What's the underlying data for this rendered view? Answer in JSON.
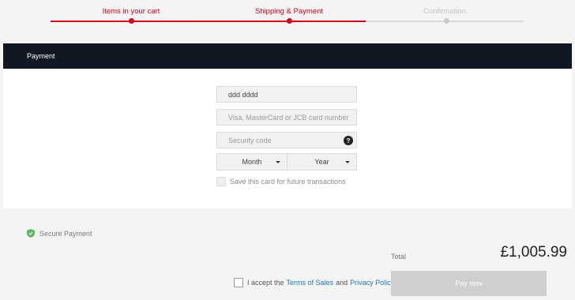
{
  "stepper": {
    "steps": [
      {
        "label": "Items in your cart",
        "state": "done"
      },
      {
        "label": "Shipping & Payment",
        "state": "current"
      },
      {
        "label": "Confirmation",
        "state": "pending"
      }
    ],
    "active_color": "#d0011b"
  },
  "payment": {
    "header": "Payment",
    "name_value": "ddd dddd",
    "card_placeholder": "Visa, MasterCard or JCB card number",
    "security_placeholder": "Security code",
    "security_help": "?",
    "month_label": "Month",
    "year_label": "Year",
    "save_card_label": "Save this card for future transactions"
  },
  "checkout": {
    "secure_label": "Secure Payment",
    "total_label": "Total",
    "total_value": "£1,005.99",
    "accept_prefix": "I accept the",
    "terms_link": "Terms of Sales",
    "and_text": "and",
    "privacy_link": "Privacy Policy.",
    "pay_button": "Pay now"
  },
  "icons": {
    "shield": "shield-check-icon",
    "caret": "chevron-down-icon",
    "help": "question-circle-icon"
  }
}
